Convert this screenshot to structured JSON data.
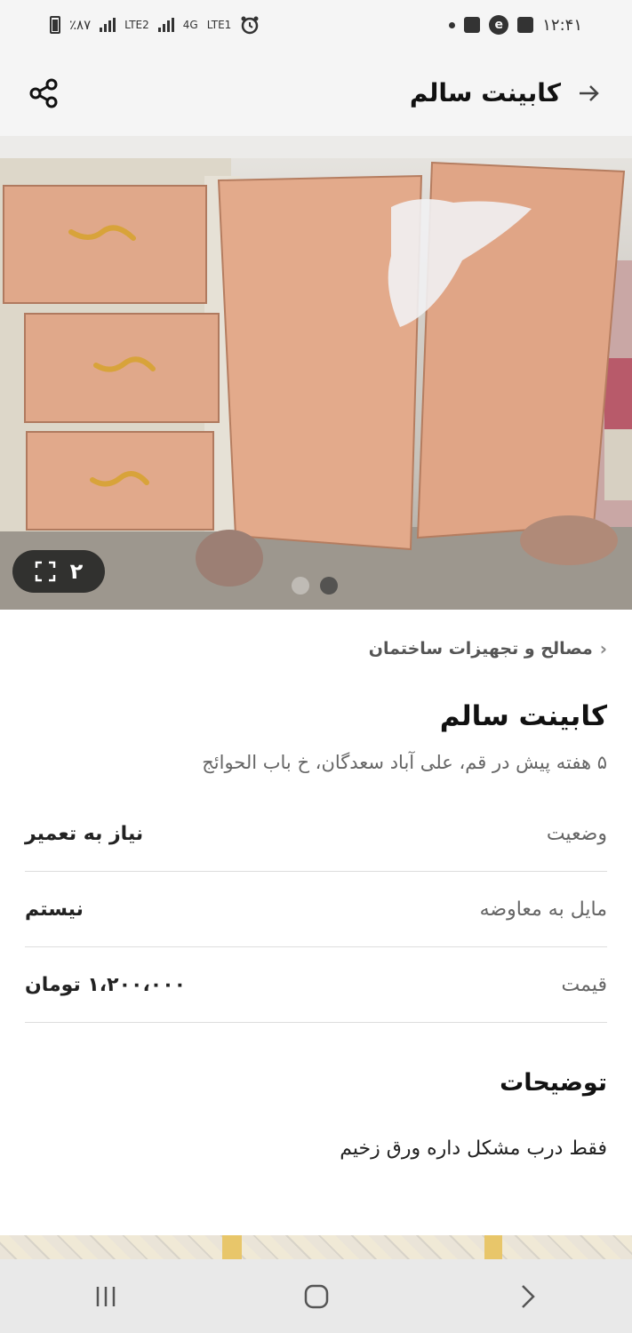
{
  "status_bar": {
    "battery_text": "٪۸۷",
    "sim1_label": "LTE2",
    "sim2_label": "LTE1",
    "network_label": "4G",
    "time": "۱۲:۴۱"
  },
  "app_bar": {
    "title": "کابینت سالم",
    "back_icon": "arrow-right-icon",
    "share_icon": "share-icon"
  },
  "gallery": {
    "photo_count": "۲",
    "total_photos": 2,
    "active_index": 1
  },
  "content": {
    "breadcrumb": "مصالح و تجهیزات ساختمان",
    "title": "کابینت سالم",
    "subtitle": "۵ هفته پیش در قم، علی آباد سعدگان، خ باب الحوائج",
    "info_rows": [
      {
        "key": "وضعیت",
        "value": "نیاز به تعمیر"
      },
      {
        "key": "مایل به معاوضه",
        "value": "نیستم"
      },
      {
        "key": "قیمت",
        "value": "۱،۲۰۰،۰۰۰ تومان"
      }
    ],
    "description_title": "توضیحات",
    "description": "فقط درب مشکل داره ورق زخیم"
  }
}
